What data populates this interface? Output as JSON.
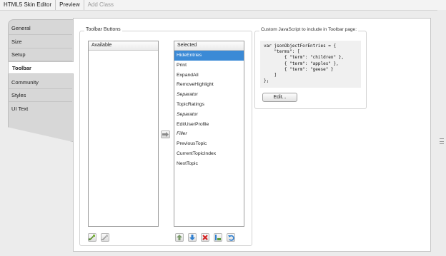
{
  "menu": {
    "items": [
      {
        "label": "HTML5 Skin Editor",
        "enabled": true
      },
      {
        "label": "Preview",
        "enabled": true
      },
      {
        "label": "Add Class",
        "enabled": false
      }
    ]
  },
  "tabs": [
    {
      "label": "General",
      "active": false
    },
    {
      "label": "Size",
      "active": false
    },
    {
      "label": "Setup",
      "active": false
    },
    {
      "label": "Toolbar",
      "active": true
    },
    {
      "label": "Community",
      "active": false
    },
    {
      "label": "Styles",
      "active": false
    },
    {
      "label": "UI Text",
      "active": false
    }
  ],
  "toolbar_buttons": {
    "legend": "Toolbar Buttons",
    "available": {
      "header": "Available",
      "items": []
    },
    "selected": {
      "header": "Selected",
      "items": [
        {
          "label": "HideEntries",
          "italic": false,
          "selected": true
        },
        {
          "label": "Print",
          "italic": false,
          "selected": false
        },
        {
          "label": "ExpandAll",
          "italic": false,
          "selected": false
        },
        {
          "label": "RemoveHighlight",
          "italic": false,
          "selected": false
        },
        {
          "label": "Separator",
          "italic": true,
          "selected": false
        },
        {
          "label": "TopicRatings",
          "italic": false,
          "selected": false
        },
        {
          "label": "Separator",
          "italic": true,
          "selected": false
        },
        {
          "label": "EditUserProfile",
          "italic": false,
          "selected": false
        },
        {
          "label": "Filler",
          "italic": true,
          "selected": false
        },
        {
          "label": "PreviousTopic",
          "italic": false,
          "selected": false
        },
        {
          "label": "CurrentTopicIndex",
          "italic": false,
          "selected": false
        },
        {
          "label": "NextTopic",
          "italic": false,
          "selected": false
        }
      ]
    }
  },
  "custom_js": {
    "legend": "Custom JavaScript to include in Toolbar page:",
    "code": "var jsonObjectForEntries = {\n    \"terms\": [\n        { \"term\": \"children\" },\n        { \"term\": \"apples\" },\n        { \"term\": \"geese\" }\n    ]\n};",
    "edit_label": "Edit..."
  },
  "colors": {
    "selection": "#3b8ad6",
    "tab_panel": "#d7d7d7",
    "accent_blue": "#2f7fd0",
    "delete_red": "#d42020"
  }
}
